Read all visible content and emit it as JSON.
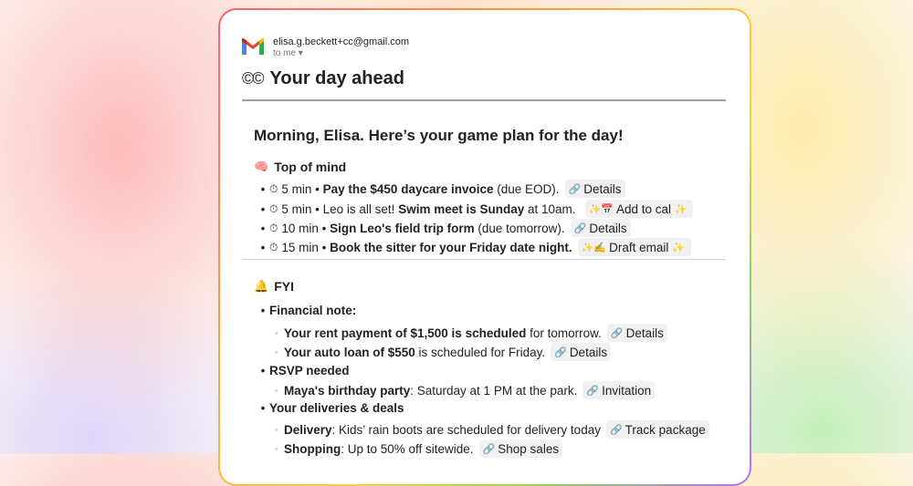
{
  "email": {
    "sender": "elisa.g.beckett+cc@gmail.com",
    "to": "to me ▾",
    "subject_logo": "©©",
    "subject": "Your day ahead",
    "greeting": "Morning, Elisa. Here’s your game plan for the day!"
  },
  "top_of_mind": {
    "heading": "Top of mind",
    "items": [
      {
        "time": "5 min •",
        "bold": "Pay the $450 daycare invoice",
        "rest": "(due EOD).",
        "chip": "Details",
        "chip_icon": "🔗"
      },
      {
        "time": "5 min •",
        "pre": "Leo is all set!",
        "bold": "Swim meet is Sunday",
        "rest": "at 10am.",
        "chip": "Add to cal",
        "chip_icon": "✨📅",
        "chip_suffix": "✨"
      },
      {
        "time": "10 min •",
        "bold": "Sign Leo's field trip form",
        "rest": "(due tomorrow).",
        "chip": "Details",
        "chip_icon": "🔗"
      },
      {
        "time": "15 min •",
        "bold": "Book the sitter for your Friday date night.",
        "rest": "",
        "chip": "Draft email",
        "chip_icon": "✨✍",
        "chip_suffix": "✨"
      }
    ]
  },
  "fyi": {
    "heading": "FYI",
    "financial": {
      "label": "Financial note:",
      "items": [
        {
          "bold": "Your rent payment of $1,500 is scheduled",
          "rest": "for tomorrow.",
          "chip": "Details"
        },
        {
          "bold": "Your auto loan of $550",
          "rest": "is scheduled for Friday.",
          "chip": "Details"
        }
      ]
    },
    "rsvp": {
      "label": "RSVP needed",
      "items": [
        {
          "bold": "Maya's birthday party",
          "rest": ": Saturday at 1 PM at the park.",
          "chip": "Invitation"
        }
      ]
    },
    "deliveries": {
      "label": "Your deliveries & deals",
      "items": [
        {
          "bold": "Delivery",
          "rest": ": Kids’ rain boots are scheduled for delivery today",
          "chip": "Track package"
        },
        {
          "bold": "Shopping",
          "rest": ": Up to 50% off sitewide.",
          "chip": "Shop sales"
        }
      ]
    }
  }
}
